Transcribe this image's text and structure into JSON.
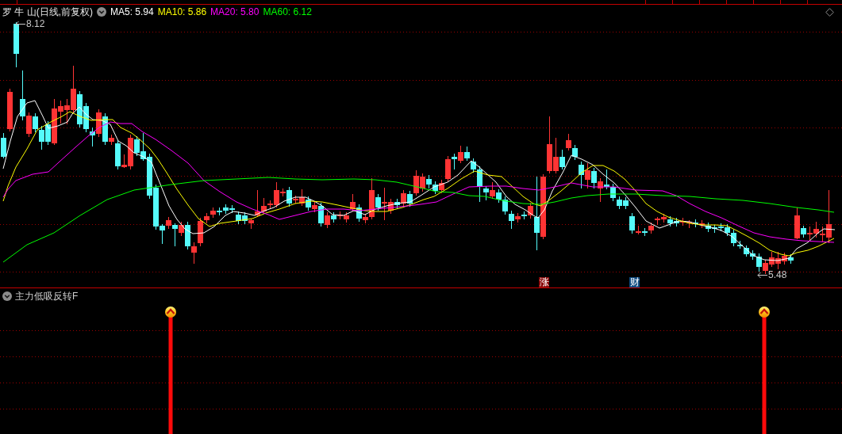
{
  "chart": {
    "title": "罗 牛 山(日线,前复权)",
    "indicators": [
      {
        "label": "MA5: 5.94",
        "color": "#ffffff"
      },
      {
        "label": "MA10: 5.86",
        "color": "#ffff00"
      },
      {
        "label": "MA20: 5.80",
        "color": "#ff00ff"
      },
      {
        "label": "MA60: 6.12",
        "color": "#00ff00"
      }
    ],
    "high_label": "8.12",
    "low_label": "5.48",
    "event_markers": [
      {
        "label": "涨",
        "color": "#8b0a0a"
      },
      {
        "label": "财",
        "color": "#0e4a80"
      }
    ]
  },
  "indicator_panel": {
    "title": "主力低吸反转F"
  }
}
